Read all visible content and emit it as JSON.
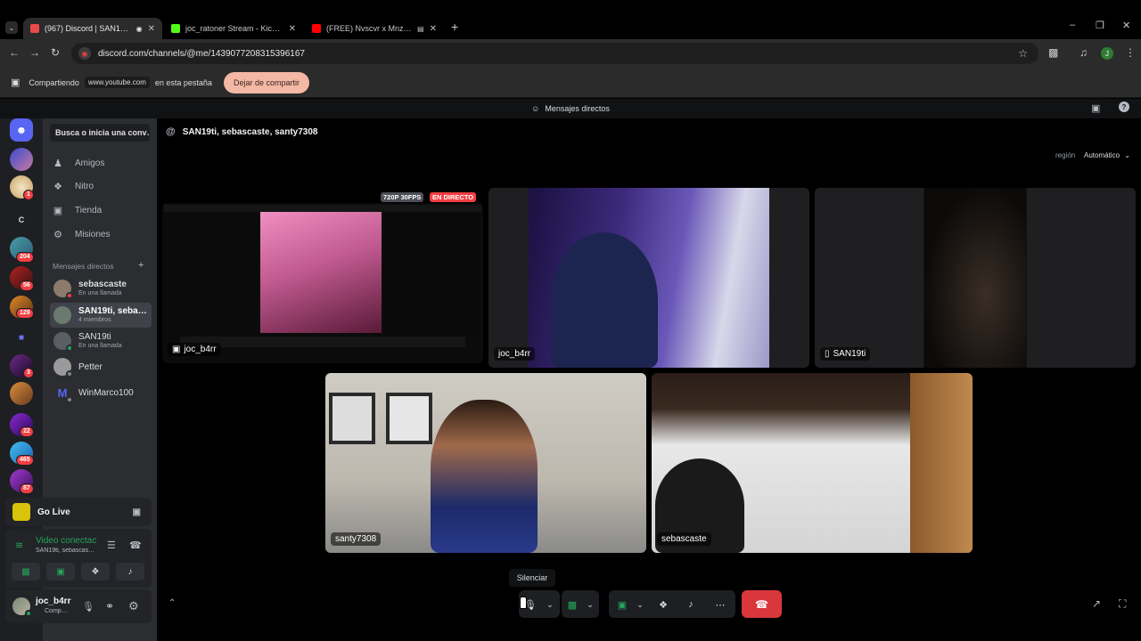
{
  "browser": {
    "tabs": [
      {
        "label": "(967) Discord | SAN19ti, sebascaste, santy7308",
        "active": true,
        "favicon_color": "#e84a4a"
      },
      {
        "label": "joc_ratoner Stream - Kick Dashboard",
        "active": false,
        "favicon_color": "#53fc18"
      },
      {
        "label": "(FREE) Nvscvr x Mnzr \"Ni te\"",
        "active": false,
        "favicon_color": "#ff0000"
      }
    ],
    "new_tab": "+",
    "url": "discord.com/channels/@me/1439077208315396167",
    "profile_initial": "J"
  },
  "share_bar": {
    "prefix": "Compartiendo",
    "site": "www.youtube.com",
    "suffix": "en esta pestaña",
    "stop_label": "Dejar de compartir"
  },
  "discord_topbar": {
    "title": "Mensajes directos"
  },
  "server_rail": {
    "badges": [
      "1",
      "204",
      "56",
      "129",
      "3",
      "22",
      "465",
      "87"
    ],
    "letter_server": "C"
  },
  "dm_sidebar": {
    "search_placeholder": "Busca o inicia una conv…",
    "nav": [
      {
        "label": "Amigos",
        "icon": "friends-icon"
      },
      {
        "label": "Nitro",
        "icon": "nitro-icon"
      },
      {
        "label": "Tienda",
        "icon": "shop-icon"
      },
      {
        "label": "Misiones",
        "icon": "quests-icon"
      }
    ],
    "dm_header": "Mensajes directos",
    "add": "+",
    "dms": [
      {
        "name": "sebascaste",
        "sub": "En una llamada",
        "selected": false,
        "avatar_color": "#8c7a6b"
      },
      {
        "name": "SAN19ti, seba…",
        "sub": "4 miembros",
        "selected": true,
        "avatar_color": "#6b7a6e"
      },
      {
        "name": "SAN19ti",
        "sub": "En una llamada",
        "selected": false,
        "avatar_color": "#5a5f66"
      },
      {
        "name": "Petter",
        "sub": "",
        "selected": false,
        "avatar_color": "#9a9a9a"
      },
      {
        "name": "WinMarco100",
        "sub": "",
        "selected": false,
        "avatar_color": "#5865f2"
      }
    ]
  },
  "golive": {
    "label": "Go Live"
  },
  "voice_panel": {
    "status": "Video conectac",
    "channel": "SAN19ti, sebascas…"
  },
  "user": {
    "name": "joc_b4rr",
    "status": "Comp…"
  },
  "call": {
    "title": "SAN19ti, sebascaste, santy7308",
    "region_label": "región",
    "region_value": "Automático",
    "stream_quality": "720P 30FPS",
    "live_badge": "EN DIRECTO",
    "tiles": [
      {
        "label": "joc_b4rr"
      },
      {
        "label": "joc_b4rr"
      },
      {
        "label": "SAN19ti"
      },
      {
        "label": "santy7308"
      },
      {
        "label": "sebascaste"
      }
    ],
    "tooltip": "Silenciar"
  }
}
